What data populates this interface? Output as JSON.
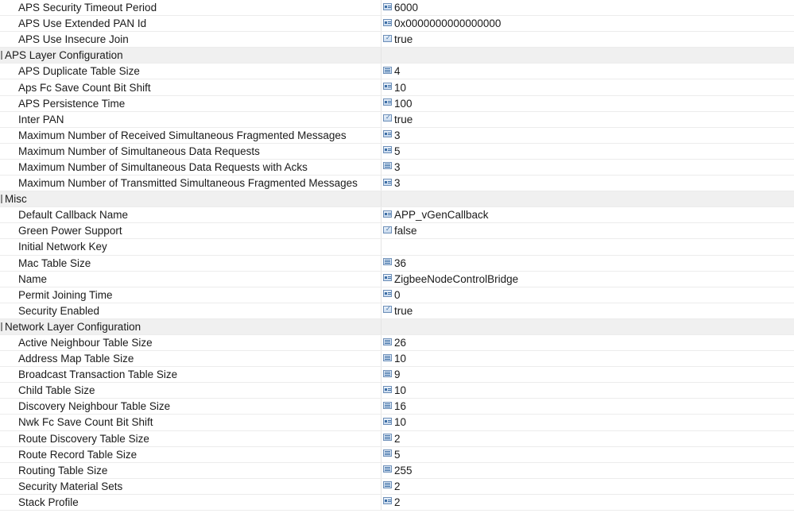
{
  "rows": [
    {
      "kind": "prop",
      "name": "APS Security Timeout Period",
      "icon": "text-field-icon",
      "value": "6000"
    },
    {
      "kind": "prop",
      "name": "APS Use Extended PAN Id",
      "icon": "text-field-icon",
      "value": "0x0000000000000000"
    },
    {
      "kind": "prop",
      "name": "APS Use Insecure Join",
      "icon": "boolean-icon",
      "value": "true"
    },
    {
      "kind": "cat",
      "name": "APS Layer Configuration"
    },
    {
      "kind": "prop",
      "name": "APS Duplicate Table Size",
      "icon": "list-field-icon",
      "value": "4"
    },
    {
      "kind": "prop",
      "name": "Aps Fc Save Count Bit Shift",
      "icon": "text-field-icon",
      "value": "10"
    },
    {
      "kind": "prop",
      "name": "APS Persistence Time",
      "icon": "text-field-icon",
      "value": "100"
    },
    {
      "kind": "prop",
      "name": "Inter PAN",
      "icon": "boolean-icon",
      "value": "true"
    },
    {
      "kind": "prop",
      "name": "Maximum Number of Received Simultaneous Fragmented Messages",
      "icon": "text-field-icon",
      "value": "3"
    },
    {
      "kind": "prop",
      "name": "Maximum Number of Simultaneous Data Requests",
      "icon": "text-field-icon",
      "value": "5"
    },
    {
      "kind": "prop",
      "name": "Maximum Number of Simultaneous Data Requests with Acks",
      "icon": "list-field-icon",
      "value": "3"
    },
    {
      "kind": "prop",
      "name": "Maximum Number of Transmitted Simultaneous Fragmented Messages",
      "icon": "text-field-icon",
      "value": "3"
    },
    {
      "kind": "cat",
      "name": "Misc"
    },
    {
      "kind": "prop",
      "name": "Default Callback Name",
      "icon": "text-field-icon",
      "value": "APP_vGenCallback"
    },
    {
      "kind": "prop",
      "name": "Green Power Support",
      "icon": "boolean-icon",
      "value": "false"
    },
    {
      "kind": "prop",
      "name": "Initial Network Key",
      "icon": "",
      "value": ""
    },
    {
      "kind": "prop",
      "name": "Mac Table Size",
      "icon": "list-field-icon",
      "value": "36"
    },
    {
      "kind": "prop",
      "name": "Name",
      "icon": "text-field-icon",
      "value": "ZigbeeNodeControlBridge"
    },
    {
      "kind": "prop",
      "name": "Permit Joining Time",
      "icon": "text-field-icon",
      "value": "0"
    },
    {
      "kind": "prop",
      "name": "Security Enabled",
      "icon": "boolean-icon",
      "value": "true"
    },
    {
      "kind": "cat",
      "name": "Network Layer Configuration"
    },
    {
      "kind": "prop",
      "name": "Active Neighbour Table Size",
      "icon": "list-field-icon",
      "value": "26"
    },
    {
      "kind": "prop",
      "name": "Address Map Table Size",
      "icon": "list-field-icon",
      "value": "10"
    },
    {
      "kind": "prop",
      "name": "Broadcast Transaction Table Size",
      "icon": "list-field-icon",
      "value": "9"
    },
    {
      "kind": "prop",
      "name": "Child Table Size",
      "icon": "text-field-icon",
      "value": "10"
    },
    {
      "kind": "prop",
      "name": "Discovery Neighbour Table Size",
      "icon": "list-field-icon",
      "value": "16"
    },
    {
      "kind": "prop",
      "name": "Nwk Fc Save Count Bit Shift",
      "icon": "text-field-icon",
      "value": "10"
    },
    {
      "kind": "prop",
      "name": "Route Discovery Table Size",
      "icon": "list-field-icon",
      "value": "2"
    },
    {
      "kind": "prop",
      "name": "Route Record Table Size",
      "icon": "list-field-icon",
      "value": "5"
    },
    {
      "kind": "prop",
      "name": "Routing Table Size",
      "icon": "list-field-icon",
      "value": "255"
    },
    {
      "kind": "prop",
      "name": "Security Material Sets",
      "icon": "list-field-icon",
      "value": "2"
    },
    {
      "kind": "prop",
      "name": "Stack Profile",
      "icon": "text-field-icon",
      "value": "2"
    }
  ]
}
